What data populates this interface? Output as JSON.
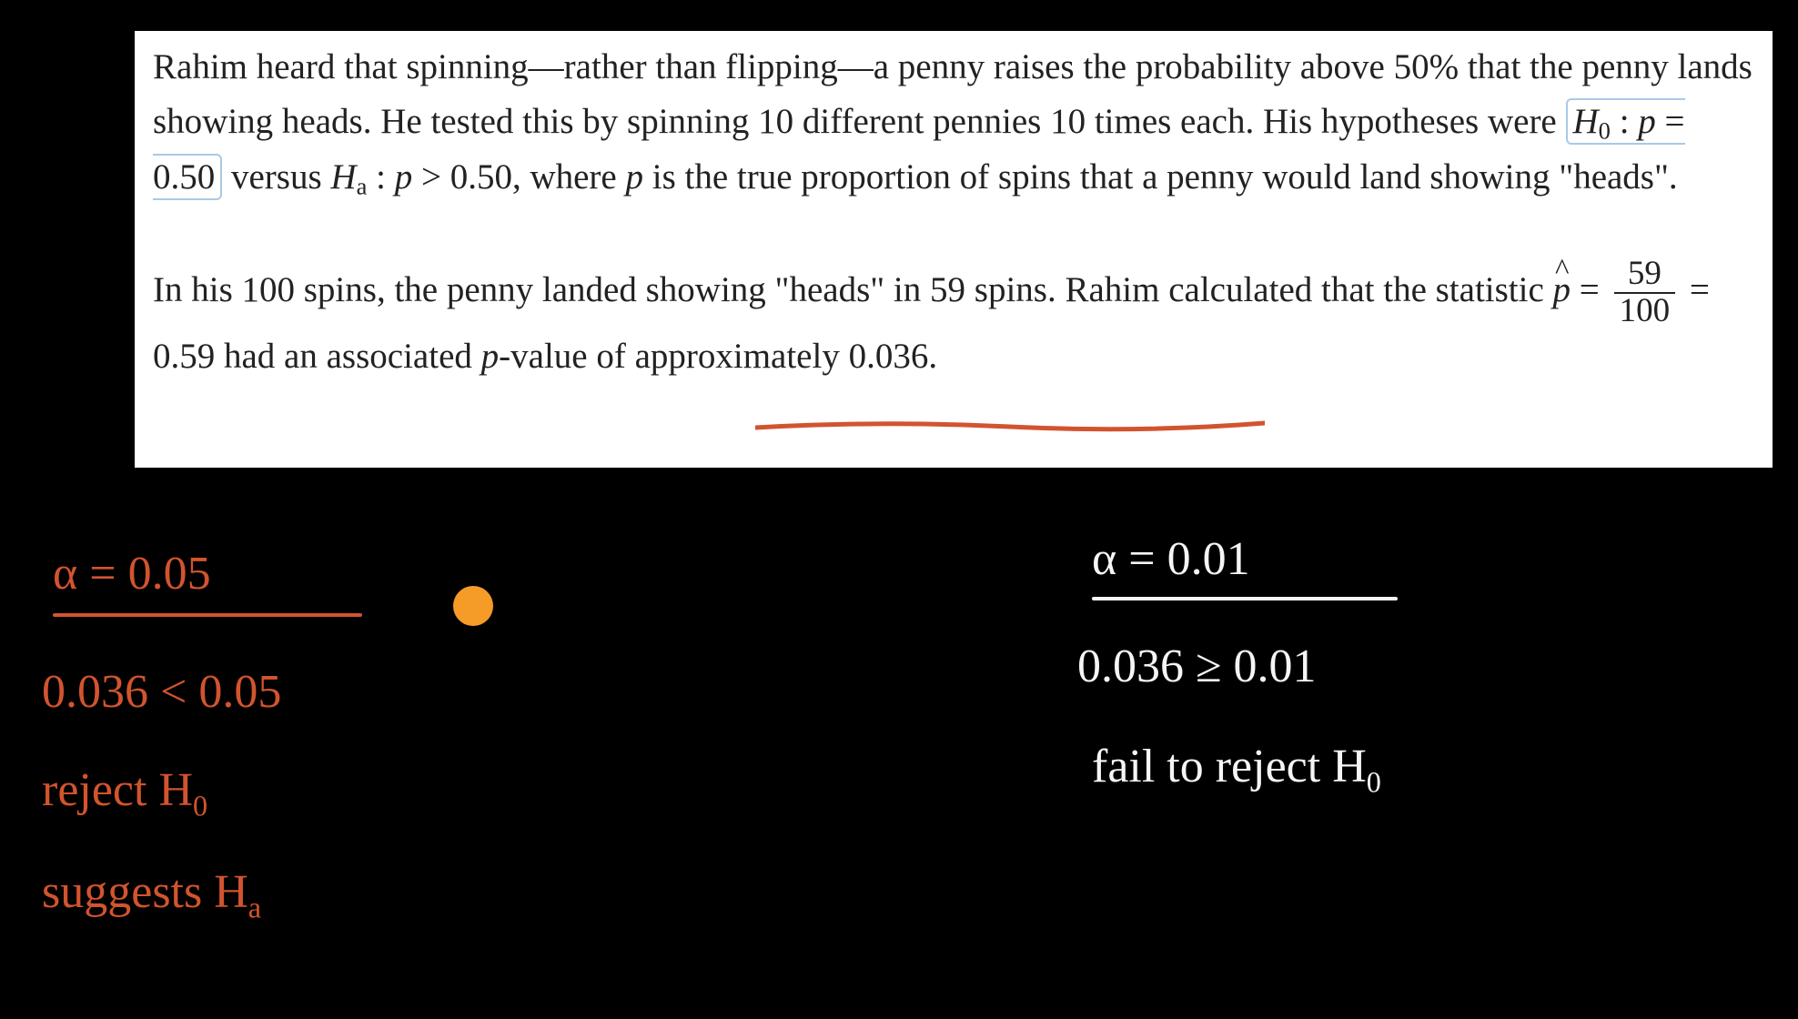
{
  "problem": {
    "para1_a": "Rahim heard that spinning—rather than flipping—a penny raises the probability above ",
    "fifty_pct": "50%",
    "para1_b": " that the penny lands showing heads. He tested this by spinning ",
    "ten_a": "10",
    "para1_c": " different pennies ",
    "ten_b": "10",
    "para1_d": " times each. His hypotheses were ",
    "h0_lhs": "H",
    "h0_sub": "0",
    "h0_colon": " : ",
    "p_var": "p",
    "eq": " = ",
    "pval050": "0.50",
    "versus": " versus ",
    "ha_lhs": "H",
    "ha_sub": "a",
    "gt": " > ",
    "pval050b": "0.50",
    "para1_e": ", where ",
    "para1_f": " is the true proportion of spins that a penny would land showing \"heads\".",
    "para2_a": "In his ",
    "hundred": "100",
    "para2_b": " spins, the penny landed showing \"heads\" in ",
    "fiftynine": "59",
    "para2_c": " spins. Rahim calculated that the statistic ",
    "phat": "p",
    "eq2": " = ",
    "frac_num": "59",
    "frac_den": "100",
    "eq3": " = ",
    "phat_val": "0.59",
    "para2_d": " had an associated ",
    "pvalue_word": "p",
    "para2_e": "-value of approximately ",
    "pvalue_num": "0.036",
    "period": "."
  },
  "left": {
    "alpha_line": "α = 0.05",
    "compare": "0.036 < 0.05",
    "reject_a": "reject H",
    "reject_sub": "0",
    "suggests_a": "suggests H",
    "suggests_sub": "a"
  },
  "right": {
    "alpha_line": "α = 0.01",
    "compare": "0.036 ≥ 0.01",
    "fail_a": "fail to reject H",
    "fail_sub": "0"
  }
}
